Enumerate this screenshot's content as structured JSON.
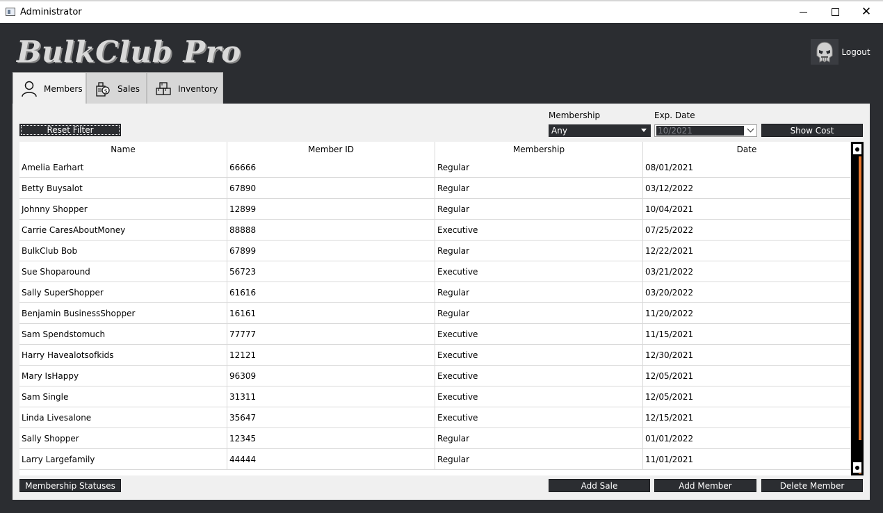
{
  "window": {
    "title": "Administrator",
    "close_glyph": "✕"
  },
  "header": {
    "logo": "BulkClub Pro",
    "logout_label": "Logout",
    "avatar_icon": "skull-mask-icon"
  },
  "tabs": [
    {
      "label": "Members",
      "icon": "user-icon",
      "active": true
    },
    {
      "label": "Sales",
      "icon": "sales-icon",
      "active": false
    },
    {
      "label": "Inventory",
      "icon": "inventory-icon",
      "active": false
    }
  ],
  "filters": {
    "reset_label": "Reset Filter",
    "membership_label": "Membership",
    "membership_value": "Any",
    "exp_date_label": "Exp. Date",
    "exp_date_value": "10/2021",
    "show_cost_label": "Show Cost"
  },
  "table": {
    "columns": [
      "Name",
      "Member ID",
      "Membership",
      "Date"
    ],
    "rows": [
      [
        "Amelia Earhart",
        "66666",
        "Regular",
        "08/01/2021"
      ],
      [
        "Betty Buysalot",
        "67890",
        "Regular",
        "03/12/2022"
      ],
      [
        "Johnny Shopper",
        "12899",
        "Regular",
        "10/04/2021"
      ],
      [
        "Carrie CaresAboutMoney",
        "88888",
        "Executive",
        "07/25/2022"
      ],
      [
        "BulkClub Bob",
        "67899",
        "Regular",
        "12/22/2021"
      ],
      [
        "Sue Shoparound",
        "56723",
        "Executive",
        "03/21/2022"
      ],
      [
        "Sally SuperShopper",
        "61616",
        "Regular",
        "03/20/2022"
      ],
      [
        "Benjamin BusinessShopper",
        "16161",
        "Regular",
        "11/20/2022"
      ],
      [
        "Sam Spendstomuch",
        "77777",
        "Executive",
        "11/15/2021"
      ],
      [
        "Harry Havealotsofkids",
        "12121",
        "Executive",
        "12/30/2021"
      ],
      [
        "Mary IsHappy",
        "96309",
        "Executive",
        "12/05/2021"
      ],
      [
        "Sam Single",
        "31311",
        "Executive",
        "12/05/2021"
      ],
      [
        "Linda Livesalone",
        "35647",
        "Executive",
        "12/15/2021"
      ],
      [
        "Sally Shopper",
        "12345",
        "Regular",
        "01/01/2022"
      ],
      [
        "Larry Largefamily",
        "44444",
        "Regular",
        "11/01/2021"
      ]
    ]
  },
  "actions": {
    "membership_statuses": "Membership Statuses",
    "add_sale": "Add Sale",
    "add_member": "Add Member",
    "delete_member": "Delete Member"
  },
  "colors": {
    "background": "#2b2d31",
    "panel": "#f0f0f0",
    "accent": "#e8772e"
  }
}
